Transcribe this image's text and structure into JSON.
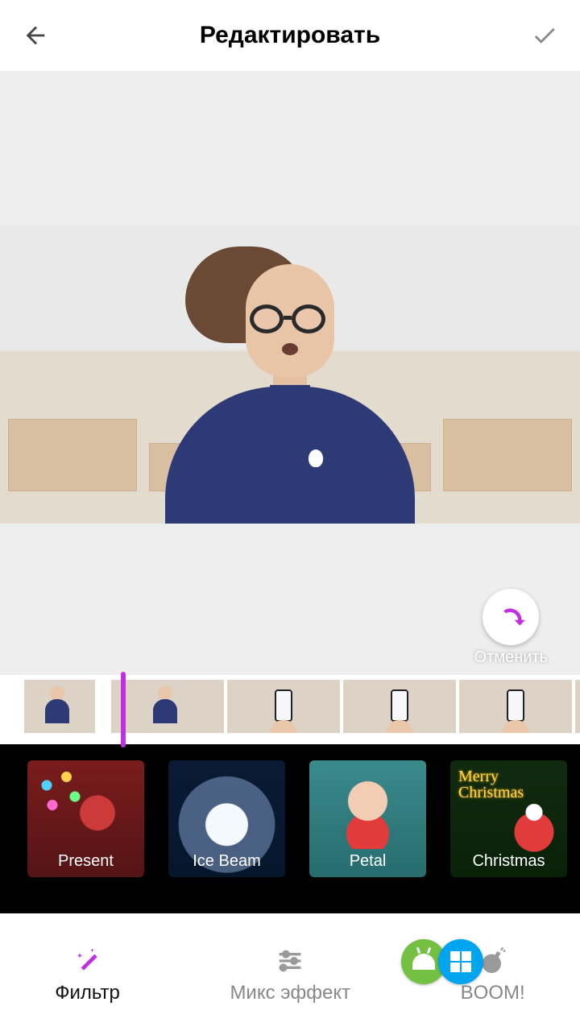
{
  "header": {
    "title": "Редактировать"
  },
  "undo": {
    "label": "Отменить"
  },
  "effects": [
    {
      "label": "Present"
    },
    {
      "label": "Ice Beam"
    },
    {
      "label": "Petal"
    },
    {
      "label": "Christmas"
    }
  ],
  "christmas_overlay": {
    "line1": "Merry",
    "line2": "Christmas"
  },
  "tabs": [
    {
      "label": "Фильтр",
      "active": true
    },
    {
      "label": "Микс эффект",
      "active": false
    },
    {
      "label": "BOOM!",
      "active": false
    }
  ]
}
